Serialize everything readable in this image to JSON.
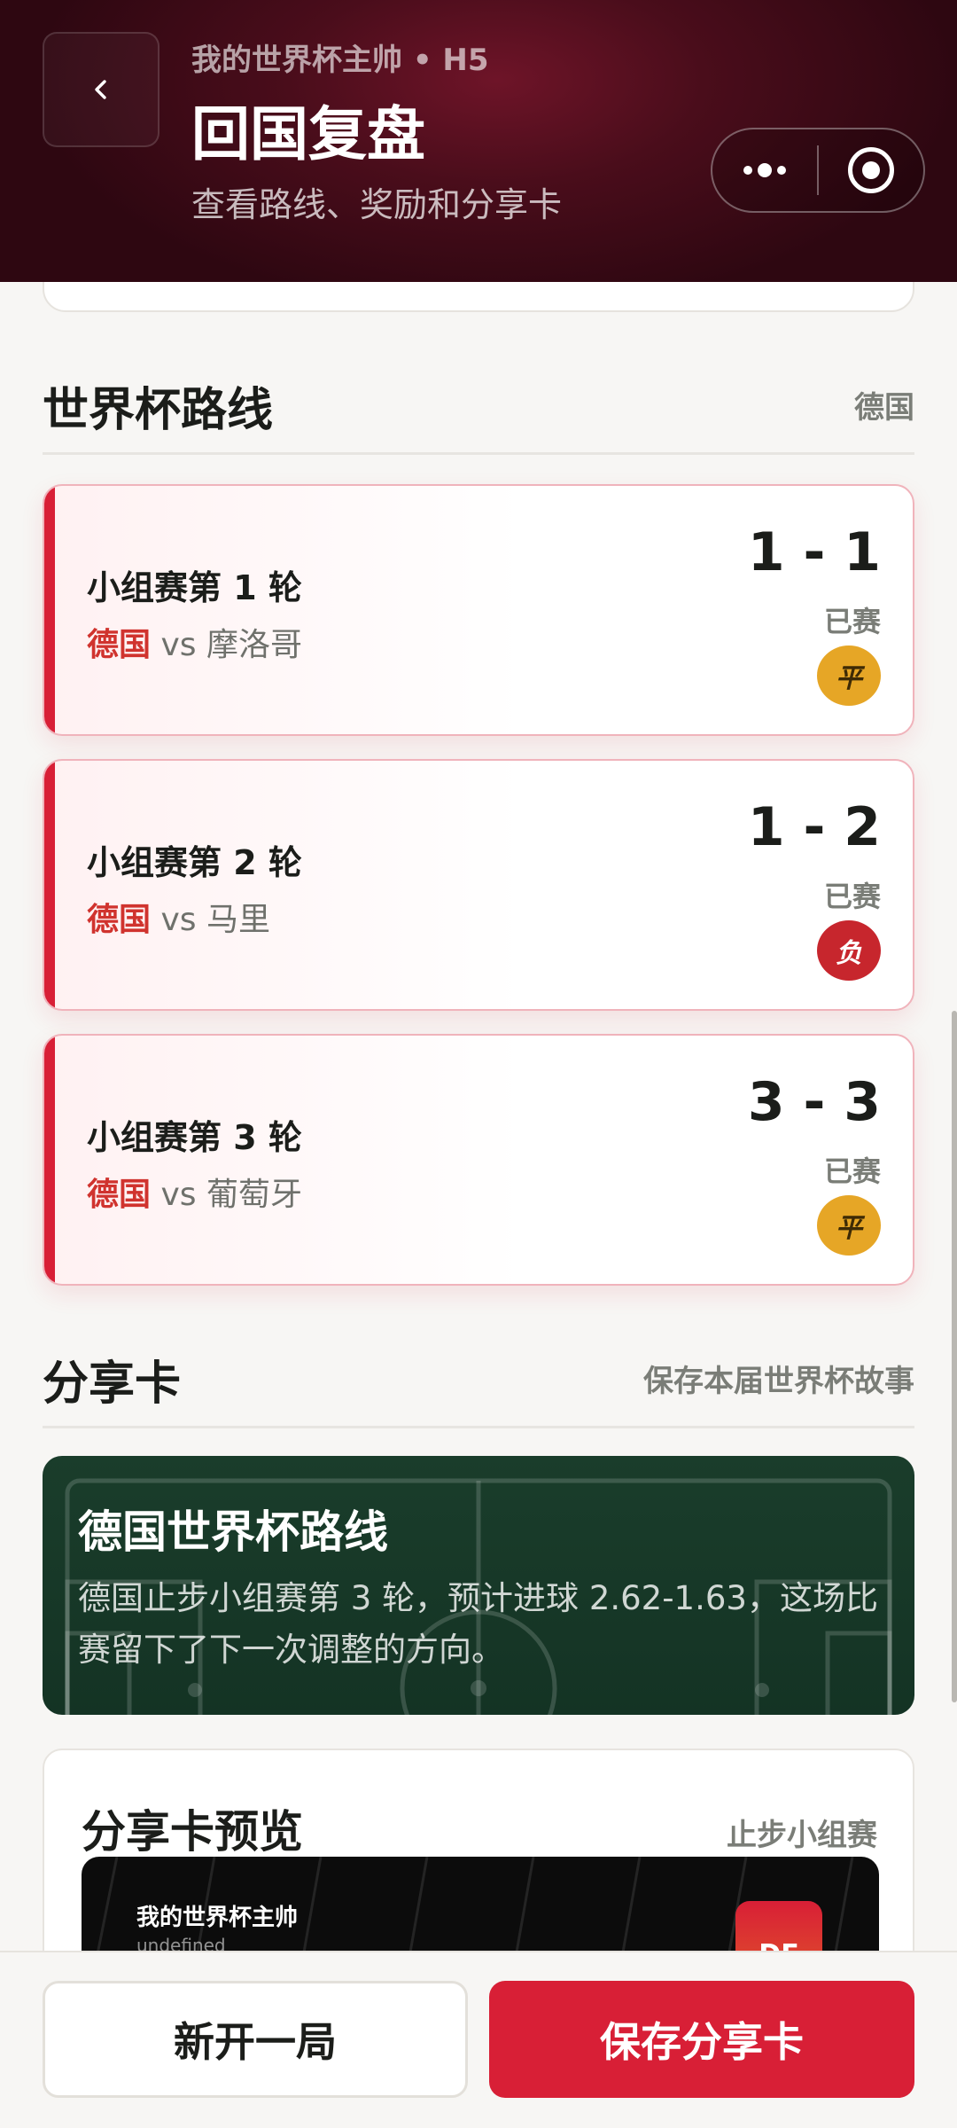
{
  "header": {
    "app_line": "我的世界杯主帅 • H5",
    "title": "回国复盘",
    "subtitle": "查看路线、奖励和分享卡"
  },
  "icons": {
    "back": "chevron-left-icon",
    "more": "more-dots-icon",
    "close": "target-close-icon"
  },
  "route_section": {
    "title": "世界杯路线",
    "team": "德国"
  },
  "matches": [
    {
      "round": "小组赛第 1 轮",
      "home": "德国",
      "vs": "vs",
      "away": "摩洛哥",
      "score": "1 - 1",
      "status": "已赛",
      "result": "平"
    },
    {
      "round": "小组赛第 2 轮",
      "home": "德国",
      "vs": "vs",
      "away": "马里",
      "score": "1 - 2",
      "status": "已赛",
      "result": "负"
    },
    {
      "round": "小组赛第 3 轮",
      "home": "德国",
      "vs": "vs",
      "away": "葡萄牙",
      "score": "3 - 3",
      "status": "已赛",
      "result": "平"
    }
  ],
  "share_section": {
    "title": "分享卡",
    "right": "保存本届世界杯故事"
  },
  "share_banner": {
    "title": "德国世界杯路线",
    "desc": "德国止步小组赛第 3 轮，预计进球 2.62-1.63，这场比赛留下了下一次调整的方向。"
  },
  "preview": {
    "title": "分享卡预览",
    "right": "止步小组赛",
    "app_name": "我的世界杯主帅",
    "undefined_text": "undefined",
    "flag_code": "DE"
  },
  "actions": {
    "new_game": "新开一局",
    "save_card": "保存分享卡"
  },
  "colors": {
    "accent": "#d81f36",
    "header_bg": "#4a0d1b",
    "draw_badge": "#e6a626",
    "loss_badge": "#c7262d",
    "pitch_green": "#1a3d2b"
  }
}
